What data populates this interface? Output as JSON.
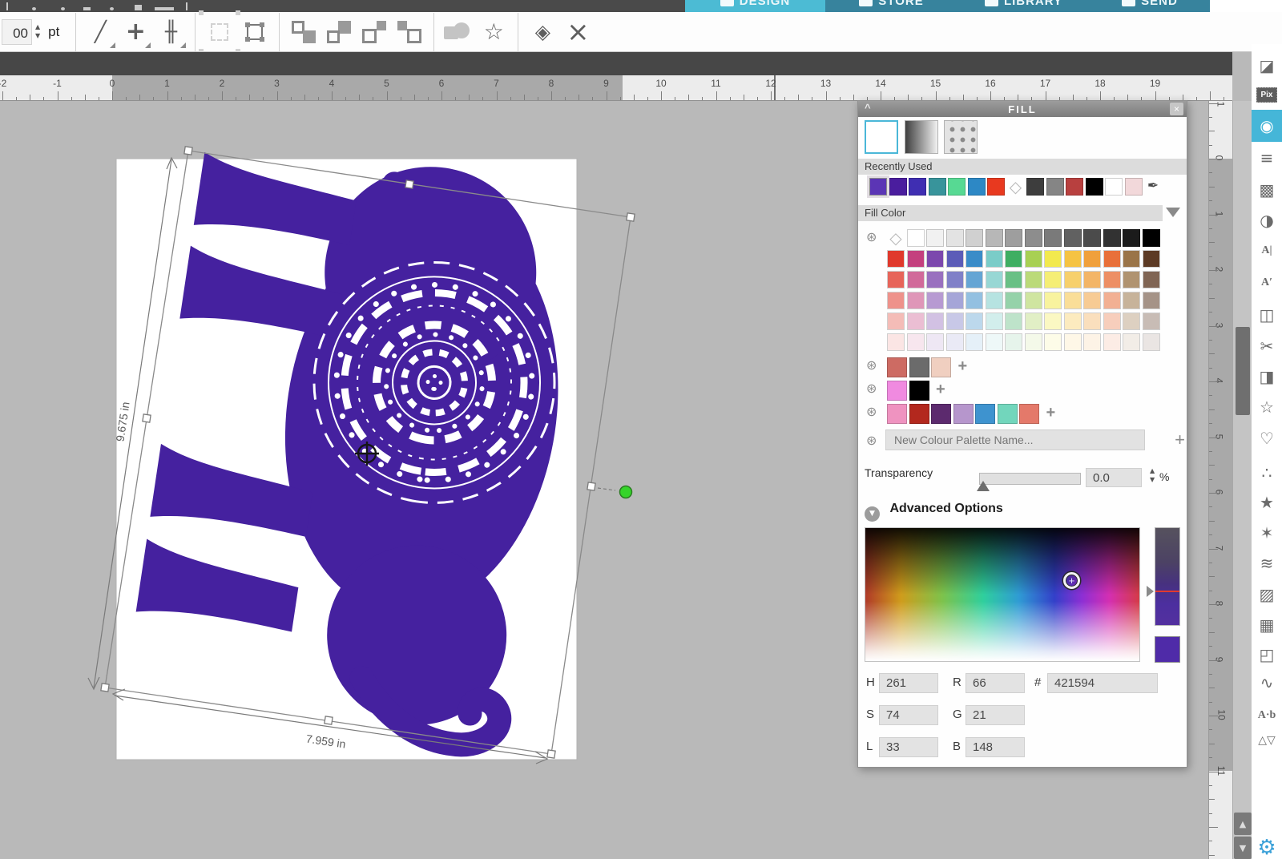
{
  "window": {
    "tabs": [
      {
        "label": "DESIGN",
        "active": true
      },
      {
        "label": "STORE",
        "active": false
      },
      {
        "label": "LIBRARY",
        "active": false
      },
      {
        "label": "SEND",
        "active": false
      }
    ]
  },
  "toolbar": {
    "font_size": "00",
    "font_unit": "pt",
    "tools": {
      "line_glyph": "╱",
      "move_glyph": "+",
      "spacing_glyph": "╫",
      "star_glyph": "☆",
      "solids_glyph": "◈",
      "close_glyph": "×"
    },
    "spinner_up": "▲",
    "spinner_down": "▼"
  },
  "rulers": {
    "horizontal": [
      "-2",
      "-1",
      "0",
      "1",
      "2",
      "3",
      "4",
      "5",
      "6",
      "7",
      "8",
      "9",
      "10",
      "11",
      "12",
      "13",
      "14",
      "15",
      "16",
      "17",
      "18",
      "19"
    ],
    "vertical": [
      "-1",
      "0",
      "1",
      "2",
      "3",
      "4",
      "5",
      "6",
      "7",
      "8",
      "9",
      "10",
      "11"
    ]
  },
  "canvas": {
    "elephant_color": "#45219f",
    "width_label": "7.959 in",
    "height_label": "9.675 in",
    "rotation_handle_color": "#35d42a"
  },
  "fill_panel": {
    "title": "FILL",
    "collapse_glyph": "^",
    "close_glyph": "×",
    "recently_used_label": "Recently Used",
    "fill_color_label": "Fill Color",
    "recent_colors": [
      "#5b35b5",
      "#4a1d9e",
      "#3f2eb2",
      "#38949b",
      "#57d993",
      "#2d88c5",
      "#e8391f",
      "TRANSPARENT",
      "#3d3d3d",
      "#858585",
      "#b8403f",
      "#000000",
      "#ffffff",
      "#f2d8da",
      "EYEDROPPER"
    ],
    "recent_selected_index": 0,
    "grid": {
      "grayscale": [
        "#ffffff",
        "#f1f1f1",
        "#e3e3e3",
        "#d0d0d0",
        "#b7b7b7",
        "#9e9e9e",
        "#8d8d8d",
        "#7a7a7a",
        "#616161",
        "#4b4b4b",
        "#323232",
        "#1b1b1b",
        "#000000"
      ],
      "base_colors": [
        "#e0392c",
        "#c4407e",
        "#7c48ad",
        "#5c5cb8",
        "#3a8cc8",
        "#7accc8",
        "#3fae62",
        "#a8d053",
        "#f2e94e",
        "#f5c343",
        "#f0a03c",
        "#e8703a",
        "#9a7448",
        "#5c3a24"
      ],
      "tint_levels": [
        0,
        0.22,
        0.45,
        0.66,
        0.87
      ]
    },
    "custom_palettes": [
      [
        "#cd6b63",
        "#6b6b6b",
        "#f0cfc0"
      ],
      [
        "#f08ae0",
        "#000000"
      ],
      [
        "#ef93c0",
        "#b3281e",
        "#5c2a6e",
        "#b696cc",
        "#3e93cf",
        "#72d6bc",
        "#e4796a"
      ]
    ],
    "new_palette_placeholder": "New Colour Palette Name...",
    "add_glyph": "+",
    "transparency": {
      "label": "Transparency",
      "value": "0.0",
      "unit": "%"
    },
    "advanced": {
      "label": "Advanced Options",
      "fields": {
        "h": {
          "label": "H",
          "value": "261"
        },
        "s": {
          "label": "S",
          "value": "74"
        },
        "l": {
          "label": "L",
          "value": "33"
        },
        "r": {
          "label": "R",
          "value": "66"
        },
        "g": {
          "label": "G",
          "value": "21"
        },
        "b": {
          "label": "B",
          "value": "148"
        },
        "hex": {
          "label": "#",
          "value": "421594"
        }
      },
      "preview_color": "#4f2ba8"
    }
  },
  "sidebar": {
    "items": [
      {
        "name": "page-setup",
        "glyph": "◪"
      },
      {
        "name": "pixscape",
        "glyph": "Pix",
        "type": "pix"
      },
      {
        "name": "fill-color",
        "glyph": "◉",
        "active": true
      },
      {
        "name": "line-style",
        "glyph": "≡"
      },
      {
        "name": "cut-style",
        "glyph": "▩"
      },
      {
        "name": "shadow",
        "glyph": "◑"
      },
      {
        "name": "text-style",
        "glyph": "A|",
        "type": "txt"
      },
      {
        "name": "character",
        "glyph": "A′",
        "type": "txt"
      },
      {
        "name": "transform",
        "glyph": "◫"
      },
      {
        "name": "knife",
        "glyph": "✂"
      },
      {
        "name": "modify",
        "glyph": "◨"
      },
      {
        "name": "offset",
        "glyph": "☆"
      },
      {
        "name": "sketch",
        "glyph": "♡"
      },
      {
        "name": "trace",
        "glyph": "∴"
      },
      {
        "name": "star-effects",
        "glyph": "★"
      },
      {
        "name": "pixscan",
        "glyph": "✶"
      },
      {
        "name": "layers",
        "glyph": "≋"
      },
      {
        "name": "hatch-fill",
        "glyph": "▨"
      },
      {
        "name": "rhinestone",
        "glyph": "▦"
      },
      {
        "name": "pop-out-cut",
        "glyph": "◰"
      },
      {
        "name": "warp",
        "glyph": "∿"
      },
      {
        "name": "text-to-path",
        "glyph": "A·b",
        "type": "txt"
      },
      {
        "name": "nesting",
        "glyph": "△▽",
        "type": "txt"
      }
    ],
    "settings_gear": {
      "name": "preferences",
      "glyph": "⚙",
      "color": "#3aa0d8"
    }
  }
}
